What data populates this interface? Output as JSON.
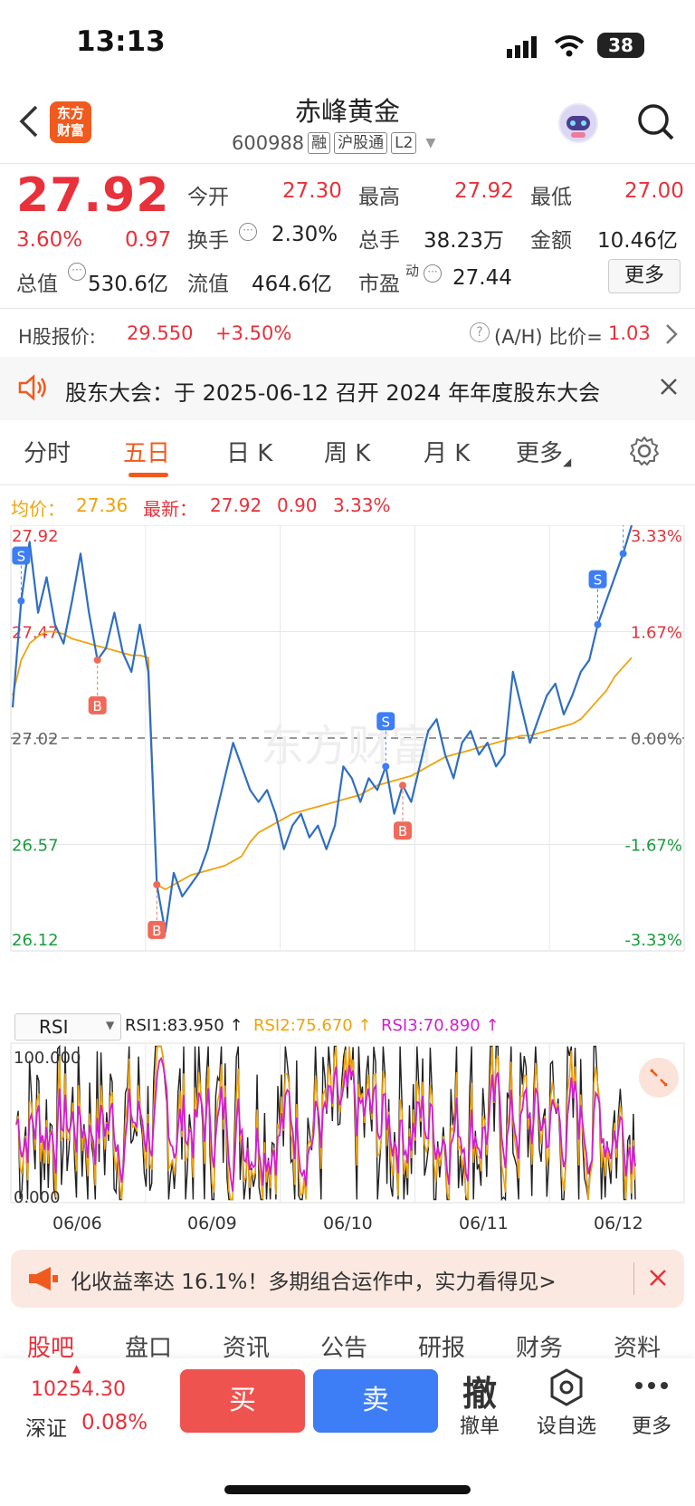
{
  "status_bar": {
    "time": "13:13",
    "battery": "38"
  },
  "header": {
    "title": "赤峰黄金",
    "code": "600988",
    "tags": [
      "融",
      "沪股通",
      "L2"
    ],
    "logo_text_line1": "东方",
    "logo_text_line2": "财富"
  },
  "quote": {
    "price": "27.92",
    "change_pct": "3.60%",
    "change": "0.97",
    "open_label": "今开",
    "open": "27.30",
    "high_label": "最高",
    "high": "27.92",
    "low_label": "最低",
    "low": "27.00",
    "turnover_label": "换手",
    "turnover": "2.30%",
    "volume_label": "总手",
    "volume": "38.23万",
    "amount_label": "金额",
    "amount": "10.46亿",
    "mktcap_label": "总值",
    "mktcap": "530.6亿",
    "float_label": "流值",
    "float_cap": "464.6亿",
    "pe_label": "市盈",
    "pe_sup": "动",
    "pe": "27.44",
    "more_button": "更多"
  },
  "hshare": {
    "label": "H股报价:",
    "price": "29.550",
    "change": "+3.50%",
    "ratio_label": "(A/H) 比价=",
    "ratio": "1.03"
  },
  "notice": {
    "text": "股东大会：于 2025-06-12 召开 2024 年年度股东大会"
  },
  "tabs": [
    "分时",
    "五日",
    "日 K",
    "周 K",
    "月 K",
    "更多"
  ],
  "active_tab": "五日",
  "chart_info": {
    "avg_label": "均价：",
    "avg": "27.36",
    "latest_label": "最新：",
    "latest": "27.92",
    "latest_change": "0.90",
    "latest_pct": "3.33%"
  },
  "indicator": {
    "name": "RSI",
    "rsi1": "RSI1:83.950 ↑",
    "rsi2": "RSI2:75.670 ↑",
    "rsi3": "RSI3:70.890 ↑",
    "max_label": "100.000",
    "min_label": "0.000"
  },
  "chart_data": {
    "type": "line",
    "title": "",
    "x_dates": [
      "06/06",
      "06/09",
      "06/10",
      "06/11",
      "06/12"
    ],
    "y_ticks_left": [
      "27.92",
      "27.47",
      "27.02",
      "26.57",
      "26.12"
    ],
    "y_ticks_right": [
      "3.33%",
      "1.67%",
      "0.00%",
      "-1.67%",
      "-3.33%"
    ],
    "ylim": [
      26.12,
      27.92
    ],
    "prev_close": 27.02,
    "series": [
      {
        "name": "",
        "color": "#2f6ec2",
        "values": [
          27.15,
          27.6,
          27.85,
          27.55,
          27.7,
          27.5,
          27.42,
          27.6,
          27.8,
          27.55,
          27.35,
          27.4,
          27.55,
          27.38,
          27.3,
          27.5,
          27.3,
          26.4,
          26.2,
          26.45,
          26.35,
          26.4,
          26.45,
          26.55,
          26.7,
          26.85,
          27.0,
          26.9,
          26.8,
          26.75,
          26.8,
          26.7,
          26.55,
          26.65,
          26.7,
          26.6,
          26.65,
          26.55,
          26.65,
          26.9,
          26.85,
          26.75,
          26.85,
          26.8,
          26.9,
          26.7,
          26.82,
          26.75,
          26.9,
          27.05,
          27.1,
          26.95,
          26.85,
          27.0,
          27.05,
          26.95,
          27.0,
          26.9,
          26.95,
          27.3,
          27.15,
          27.0,
          27.1,
          27.2,
          27.25,
          27.12,
          27.2,
          27.3,
          27.35,
          27.5,
          27.6,
          27.7,
          27.8,
          27.92
        ],
        "marker_points": [
          {
            "label": "S",
            "i": 1,
            "kind": "sell"
          },
          {
            "label": "B",
            "i": 10,
            "kind": "buy"
          },
          {
            "label": "B",
            "i": 17,
            "kind": "buy"
          },
          {
            "label": "S",
            "i": 44,
            "kind": "sell"
          },
          {
            "label": "B",
            "i": 46,
            "kind": "buy"
          },
          {
            "label": "S",
            "i": 69,
            "kind": "sell"
          },
          {
            "label": "S",
            "i": 72,
            "kind": "sell"
          }
        ]
      },
      {
        "name": "均价",
        "color": "#f0a20b",
        "values": [
          27.2,
          27.35,
          27.42,
          27.45,
          27.47,
          27.47,
          27.46,
          27.44,
          27.43,
          27.42,
          27.41,
          27.4,
          27.39,
          27.38,
          27.37,
          27.37,
          27.36,
          26.4,
          26.38,
          26.4,
          26.42,
          26.44,
          26.45,
          26.46,
          26.47,
          26.48,
          26.5,
          26.52,
          26.58,
          26.62,
          26.64,
          26.66,
          26.68,
          26.7,
          26.71,
          26.72,
          26.73,
          26.74,
          26.75,
          26.76,
          26.77,
          26.78,
          26.8,
          26.82,
          26.83,
          26.84,
          26.85,
          26.86,
          26.88,
          26.9,
          26.92,
          26.94,
          26.95,
          26.96,
          26.97,
          26.98,
          26.99,
          27.0,
          27.01,
          27.02,
          27.03,
          27.03,
          27.04,
          27.05,
          27.06,
          27.07,
          27.08,
          27.1,
          27.14,
          27.18,
          27.22,
          27.28,
          27.32,
          27.36
        ]
      }
    ]
  },
  "ad": {
    "text": "化收益率达 16.1%！多期组合运作中，实力看得见>"
  },
  "bottom_tabs": [
    "股吧",
    "盘口",
    "资讯",
    "公告",
    "研报",
    "财务",
    "资料"
  ],
  "index": {
    "value": "10254.30",
    "name": "深证",
    "pct": "0.08%"
  },
  "actions": {
    "buy": "买",
    "sell": "卖",
    "cancel_icon": "撤",
    "cancel": "撤单",
    "watch": "设自选",
    "more": "更多"
  },
  "colors": {
    "up": "#e8313a",
    "down": "#1a9d3c",
    "accent": "#f05a1e",
    "buy": "#ef5350",
    "sell": "#3d7df5"
  }
}
